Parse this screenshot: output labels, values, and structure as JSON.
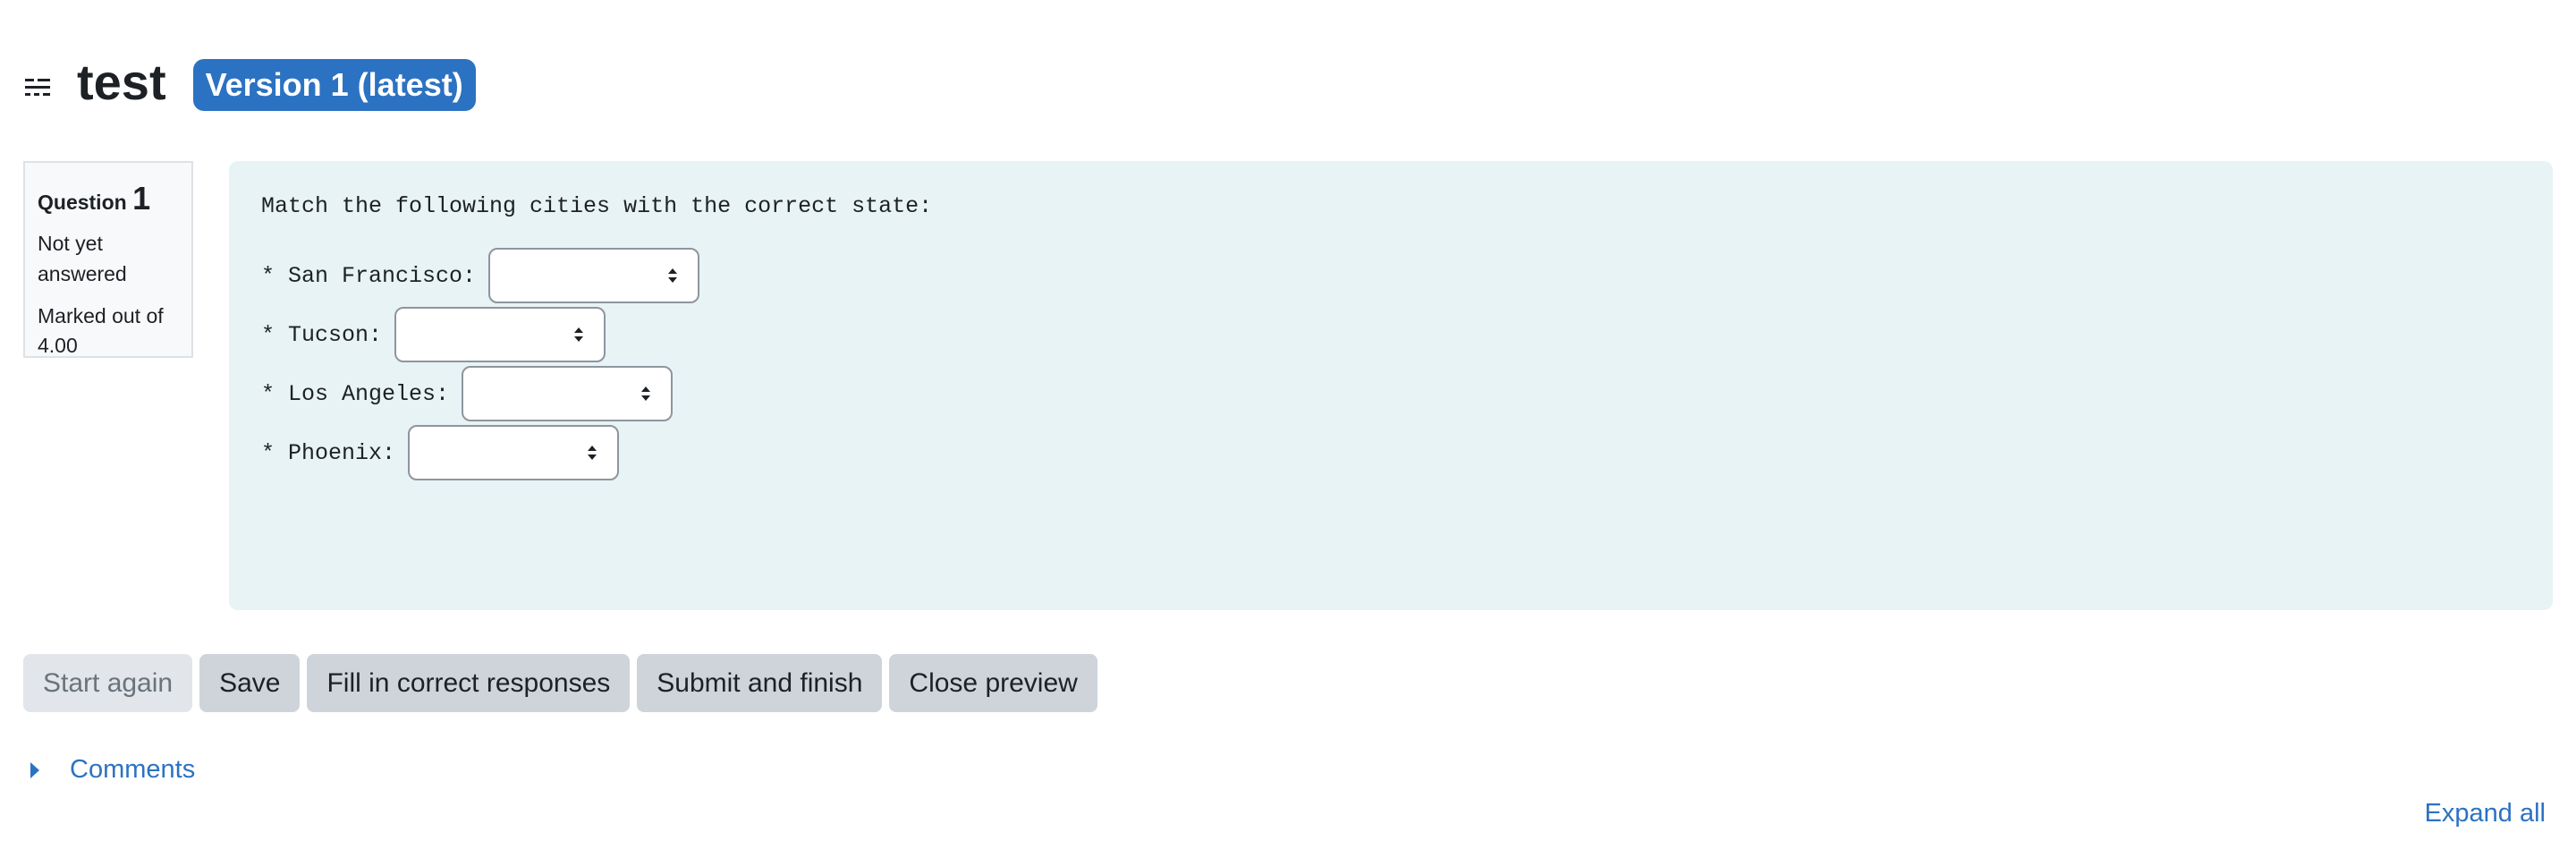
{
  "header": {
    "title": "test",
    "version_badge": "Version 1 (latest)",
    "icon": "question-type-icon"
  },
  "info": {
    "question_label": "Question",
    "question_number": "1",
    "state": "Not yet answered",
    "marked_out_of": "Marked out of 4.00"
  },
  "question": {
    "prompt": "Match the following cities with the correct state:",
    "items": [
      {
        "label": "* San Francisco:",
        "selected": ""
      },
      {
        "label": "* Tucson:",
        "selected": ""
      },
      {
        "label": "* Los Angeles:",
        "selected": ""
      },
      {
        "label": "* Phoenix:",
        "selected": ""
      }
    ]
  },
  "buttons": {
    "start_again": "Start again",
    "save": "Save",
    "fill_correct": "Fill in correct responses",
    "submit_finish": "Submit and finish",
    "close_preview": "Close preview"
  },
  "comments": {
    "label": "Comments",
    "expand_all": "Expand all"
  },
  "colors": {
    "accent": "#2c72c2",
    "content_bg": "#e7f3f5",
    "button_bg": "#ced4da"
  }
}
